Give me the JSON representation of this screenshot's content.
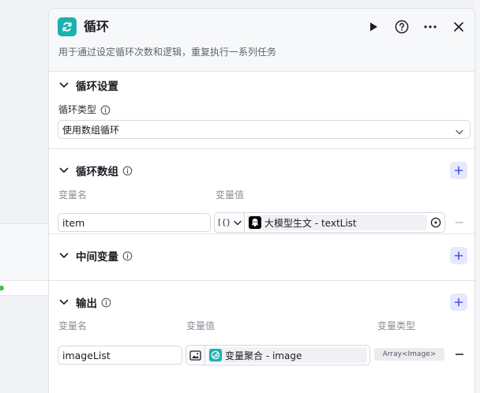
{
  "panel": {
    "title": "循环",
    "description": "用于通过设定循环次数和逻辑，重复执行一系列任务",
    "icons": {
      "node": "loop-icon",
      "run": "play-icon",
      "help": "help-circle-icon",
      "more": "more-dots-icon",
      "close": "close-icon"
    }
  },
  "loop_settings": {
    "title": "循环设置",
    "type_label": "循环类型",
    "type_value": "使用数组循环"
  },
  "loop_array": {
    "title": "循环数组",
    "col_name": "变量名",
    "col_value": "变量值",
    "rows": [
      {
        "name": "item",
        "type_icon": "braces-array-icon",
        "source_icon": "llm-avatar-icon",
        "reference": "大模型生文 - textList"
      }
    ]
  },
  "intermediate": {
    "title": "中间变量"
  },
  "output": {
    "title": "输出",
    "col_name": "变量名",
    "col_value": "变量值",
    "col_type": "变量类型",
    "rows": [
      {
        "name": "imageList",
        "type_icon": "image-icon",
        "source_icon": "aggregate-icon",
        "reference": "变量聚合 - image",
        "var_type": "Array<Image>"
      }
    ]
  },
  "colors": {
    "accent": "#4d53e8",
    "accent_bg": "#e6e8fd",
    "node": "#1bb1b1"
  }
}
